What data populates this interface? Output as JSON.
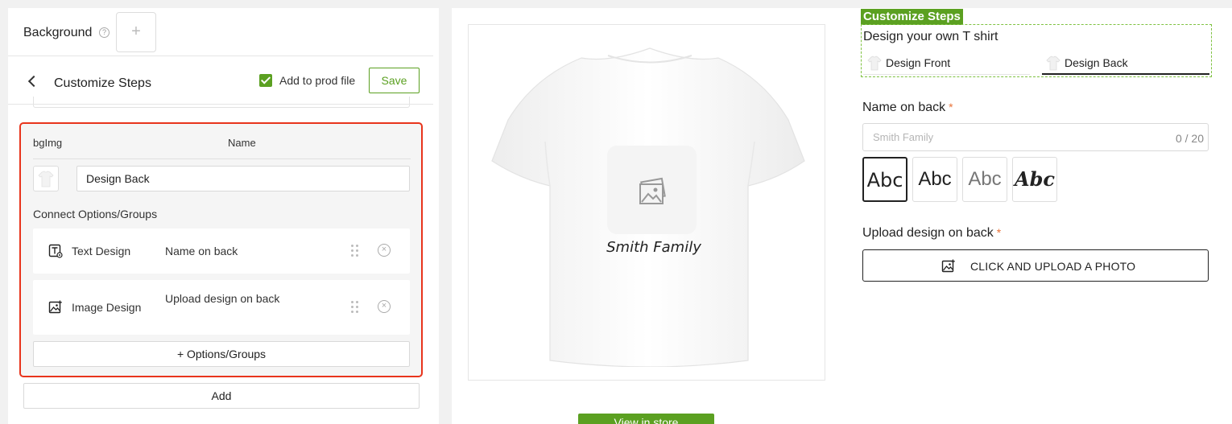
{
  "left": {
    "background_label": "Background",
    "background_add_symbol": "+",
    "help_symbol": "?",
    "steps_header": {
      "title": "Customize Steps",
      "add_to_prod_file_label": "Add to prod file",
      "add_to_prod_file_checked": true,
      "save_label": "Save"
    },
    "step": {
      "col_bgimg": "bgImg",
      "col_name": "Name",
      "name_value": "Design Back",
      "connect_label": "Connect Options/Groups",
      "options": [
        {
          "type": "Text Design",
          "value": "Name on back",
          "icon": "text-design-icon"
        },
        {
          "type": "Image Design",
          "value": "Upload design on back",
          "icon": "image-design-icon"
        }
      ],
      "add_option_label": "+ Options/Groups"
    },
    "add_label": "Add"
  },
  "preview": {
    "shirt_text": "Smith Family",
    "view_button_label": "View in store",
    "steps_badge": "Customize Steps",
    "design_title": "Design your own T shirt",
    "tabs": [
      {
        "label": "Design Front",
        "active": false
      },
      {
        "label": "Design Back",
        "active": true
      }
    ],
    "name_field": {
      "label": "Name on back",
      "required_mark": "*",
      "placeholder": "Smith Family",
      "counter": "0 / 20"
    },
    "font_options": [
      "Abc",
      "Abc",
      "Abc",
      "Abc"
    ],
    "upload": {
      "label": "Upload design on back",
      "required_mark": "*",
      "button_label": "CLICK AND UPLOAD A PHOTO"
    }
  },
  "colors": {
    "accent": "#5ba021",
    "highlight_border": "#e8341c",
    "required": "#e8733a"
  }
}
